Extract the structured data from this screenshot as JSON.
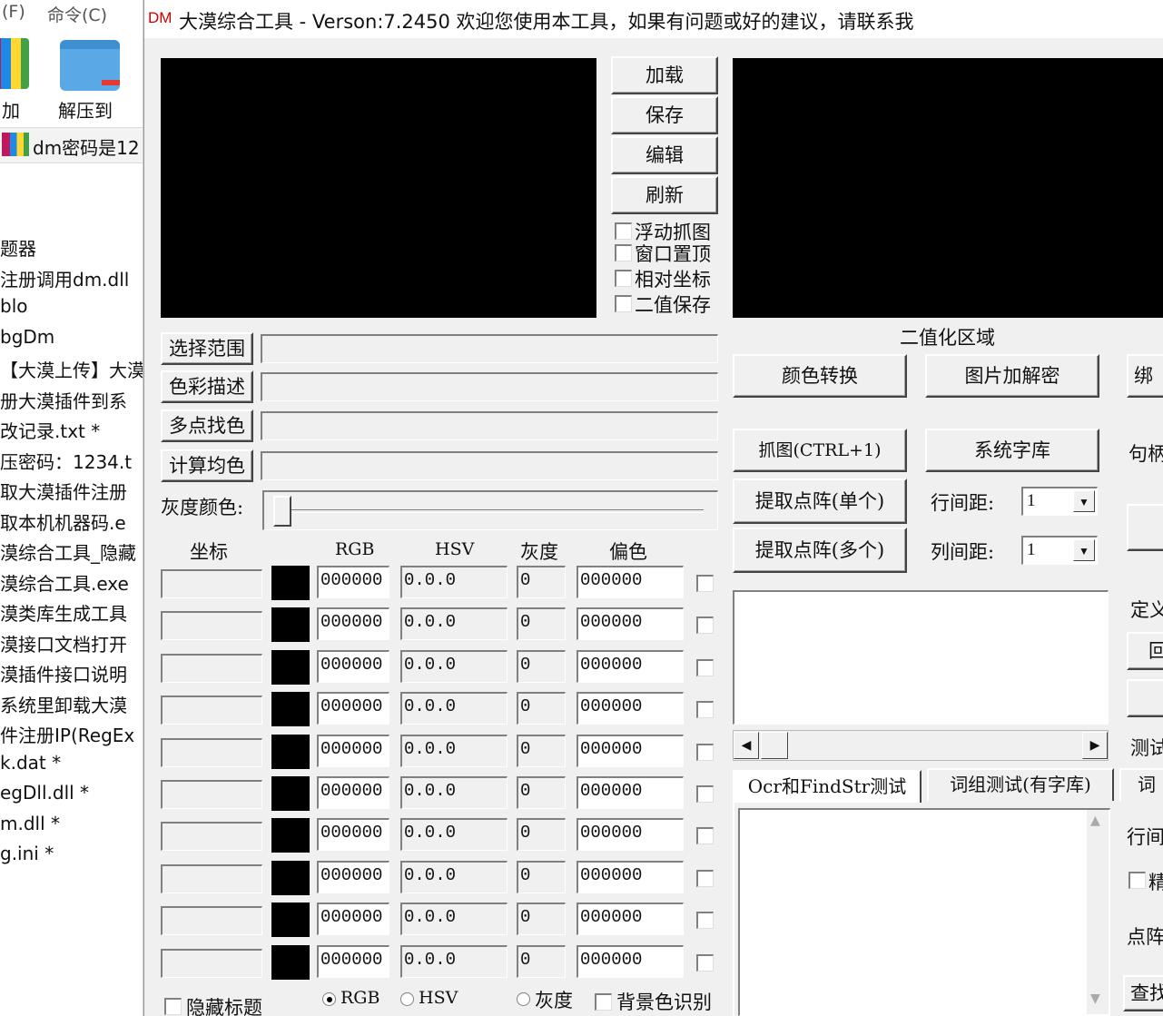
{
  "background": {
    "menu": [
      "(F)",
      "命令(C)"
    ],
    "toolbar": [
      "加",
      "解压到"
    ],
    "archive_name": "dm密码是12",
    "files": [
      "题器",
      "注册调用dm.dll",
      "blo",
      "bgDm",
      "【大漠上传】大漠",
      "册大漠插件到系",
      "改记录.txt *",
      "压密码：1234.t",
      "取大漠插件注册",
      "取本机机器码.e",
      "漠综合工具_隐藏",
      "漠综合工具.exe",
      "漠类库生成工具",
      "漠接口文档打开",
      "漠插件接口说明",
      "系统里卸载大漠",
      "件注册IP(RegEx",
      "k.dat *",
      "egDll.dll *",
      "m.dll *",
      "g.ini *"
    ]
  },
  "window": {
    "logo": "DM",
    "title": "大漠综合工具 -  Verson:7.2450  欢迎您使用本工具，如果有问题或好的建议，请联系我"
  },
  "top_buttons": {
    "load": "加载",
    "save": "保存",
    "edit": "编辑",
    "refresh": "刷新"
  },
  "options": [
    {
      "label": "浮动抓图",
      "checked": false
    },
    {
      "label": "窗口置顶",
      "checked": false
    },
    {
      "label": "相对坐标",
      "checked": false
    },
    {
      "label": "二值保存",
      "checked": false
    }
  ],
  "binary_area_label": "二值化区域",
  "left_actions": [
    {
      "label": "选择范围",
      "value": ""
    },
    {
      "label": "色彩描述",
      "value": ""
    },
    {
      "label": "多点找色",
      "value": ""
    },
    {
      "label": "计算均色",
      "value": ""
    }
  ],
  "gray_color_label": "灰度颜色:",
  "gray_slider_fraction": 0.0,
  "table": {
    "headers": [
      "坐标",
      "RGB",
      "HSV",
      "灰度",
      "偏色"
    ],
    "rows": [
      {
        "coord": "",
        "rgb": "000000",
        "hsv": "0.0.0",
        "gray": "0",
        "offset": "000000"
      },
      {
        "coord": "",
        "rgb": "000000",
        "hsv": "0.0.0",
        "gray": "0",
        "offset": "000000"
      },
      {
        "coord": "",
        "rgb": "000000",
        "hsv": "0.0.0",
        "gray": "0",
        "offset": "000000"
      },
      {
        "coord": "",
        "rgb": "000000",
        "hsv": "0.0.0",
        "gray": "0",
        "offset": "000000"
      },
      {
        "coord": "",
        "rgb": "000000",
        "hsv": "0.0.0",
        "gray": "0",
        "offset": "000000"
      },
      {
        "coord": "",
        "rgb": "000000",
        "hsv": "0.0.0",
        "gray": "0",
        "offset": "000000"
      },
      {
        "coord": "",
        "rgb": "000000",
        "hsv": "0.0.0",
        "gray": "0",
        "offset": "000000"
      },
      {
        "coord": "",
        "rgb": "000000",
        "hsv": "0.0.0",
        "gray": "0",
        "offset": "000000"
      },
      {
        "coord": "",
        "rgb": "000000",
        "hsv": "0.0.0",
        "gray": "0",
        "offset": "000000"
      },
      {
        "coord": "",
        "rgb": "000000",
        "hsv": "0.0.0",
        "gray": "0",
        "offset": "000000"
      }
    ]
  },
  "bottom": {
    "hide_title": "隐藏标题",
    "radios": [
      {
        "label": "RGB",
        "selected": true
      },
      {
        "label": "HSV",
        "selected": false
      },
      {
        "label": "灰度",
        "selected": false
      }
    ],
    "bg_color_recognition": "背景色识别"
  },
  "right": {
    "color_convert": "颜色转换",
    "image_encrypt": "图片加解密",
    "bind_partial": "绑",
    "capture": "抓图(CTRL+1)",
    "system_font": "系统字库",
    "handle_partial": "句柄",
    "extract_single": "提取点阵(单个)",
    "extract_multi": "提取点阵(多个)",
    "row_spacing_label": "行间距:",
    "row_spacing_value": "1",
    "col_spacing_label": "列间距:",
    "col_spacing_value": "1",
    "define_partial": "定义",
    "return_partial": "回",
    "test_partial": "测试",
    "tabs": [
      "Ocr和FindStr测试",
      "词组测试(有字库)",
      "词"
    ],
    "line_partial": "行间",
    "precise_partial": "精",
    "dot_partial": "点阵",
    "find_partial": "查找"
  }
}
